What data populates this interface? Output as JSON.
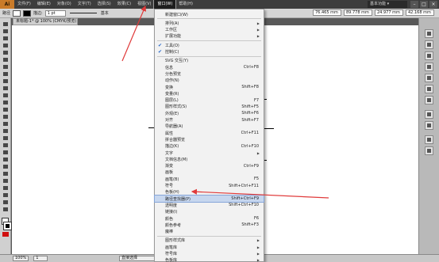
{
  "menubar": {
    "logo": "Ai",
    "items": [
      "文件(F)",
      "编辑(E)",
      "对象(O)",
      "文字(T)",
      "选择(S)",
      "效果(C)",
      "视图(V)",
      "窗口(W)",
      "帮助(H)"
    ],
    "workspace": "基本功能 ▾"
  },
  "window_controls": [
    "–",
    "□",
    "×"
  ],
  "controlbar": {
    "selection_label": "路径",
    "stroke_label": "描边:",
    "stroke_weight": "1 pt",
    "style_label": "基本",
    "x_value": "76.465 mm",
    "y_value": "89.778 mm",
    "w_value": "24.977 mm",
    "h_value": "42.168 mm"
  },
  "document_tab": "未标题-1* @ 100% (CMYK/预览)",
  "statusbar": {
    "zoom": "100%",
    "page": "1",
    "tool": "直接选择"
  },
  "window_menu": {
    "items": [
      {
        "label": "新建窗口(W)"
      },
      {
        "label": "排列(A)",
        "submenu": true
      },
      {
        "label": "工作区",
        "submenu": true
      },
      {
        "label": "扩展功能",
        "submenu": true
      },
      {
        "label": "工具(O)",
        "checked": true
      },
      {
        "label": "控制(C)",
        "checked": true
      },
      {
        "label": "SVG 交互(Y)"
      },
      {
        "label": "信息",
        "shortcut": "Ctrl+F8"
      },
      {
        "label": "分色预览"
      },
      {
        "label": "动作(N)"
      },
      {
        "label": "变换",
        "shortcut": "Shift+F8"
      },
      {
        "label": "变量(R)"
      },
      {
        "label": "图层(L)",
        "shortcut": "F7"
      },
      {
        "label": "图形样式(S)",
        "shortcut": "Shift+F5"
      },
      {
        "label": "外观(E)",
        "shortcut": "Shift+F6"
      },
      {
        "label": "对齐",
        "shortcut": "Shift+F7"
      },
      {
        "label": "导航器(A)"
      },
      {
        "label": "属性",
        "shortcut": "Ctrl+F11"
      },
      {
        "label": "拼合器预览"
      },
      {
        "label": "描边(K)",
        "shortcut": "Ctrl+F10"
      },
      {
        "label": "文字",
        "submenu": true
      },
      {
        "label": "文档信息(M)"
      },
      {
        "label": "渐变",
        "shortcut": "Ctrl+F9"
      },
      {
        "label": "画板"
      },
      {
        "label": "画笔(B)",
        "shortcut": "F5"
      },
      {
        "label": "符号",
        "shortcut": "Shift+Ctrl+F11"
      },
      {
        "label": "色板(H)"
      },
      {
        "label": "路径查找器(P)",
        "shortcut": "Shift+Ctrl+F9",
        "highlight": true
      },
      {
        "label": "透明度",
        "shortcut": "Shift+Ctrl+F10"
      },
      {
        "label": "链接(I)"
      },
      {
        "label": "颜色",
        "shortcut": "F6"
      },
      {
        "label": "颜色参考",
        "shortcut": "Shift+F3"
      },
      {
        "label": "魔棒"
      },
      {
        "label": "图形样式库",
        "submenu": true
      },
      {
        "label": "画笔库",
        "submenu": true
      },
      {
        "label": "符号库",
        "submenu": true
      },
      {
        "label": "色板库",
        "submenu": true
      }
    ]
  },
  "accent_colors": {
    "highlight": "#c7d7ef",
    "arrow": "#e03a3a",
    "check": "#2a6acb"
  }
}
